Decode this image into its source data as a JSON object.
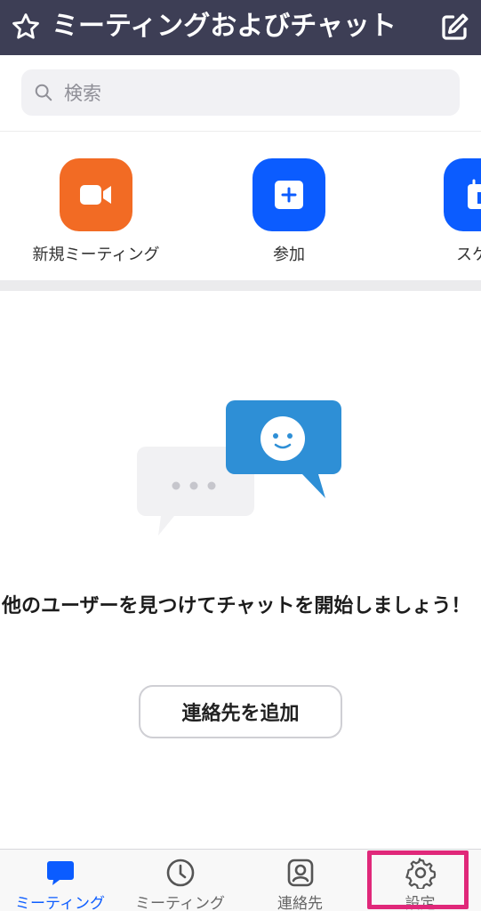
{
  "header": {
    "title": "ミーティングおよびチャット",
    "star_icon": "star-icon",
    "edit_icon": "compose-icon",
    "background_color": "#3d3e55"
  },
  "search": {
    "placeholder": "検索"
  },
  "actions": [
    {
      "label": "新規ミーティング",
      "icon": "video-camera-icon",
      "color": "#f26b24"
    },
    {
      "label": "参加",
      "icon": "plus-icon",
      "color": "#0b5cff"
    },
    {
      "label": "スケジ",
      "icon": "calendar-icon",
      "color": "#0b5cff"
    }
  ],
  "empty_state": {
    "message": "他のユーザーを見つけてチャットを開始しましょう！",
    "button_label": "連絡先を追加"
  },
  "tabbar": {
    "tabs": [
      {
        "label": "ミーティング",
        "icon": "chat-bubble-icon",
        "active": true
      },
      {
        "label": "ミーティング",
        "icon": "clock-icon",
        "active": false
      },
      {
        "label": "連絡先",
        "icon": "contact-icon",
        "active": false
      },
      {
        "label": "設定",
        "icon": "gear-icon",
        "active": false
      }
    ],
    "accent_color": "#0b5cff",
    "highlight_color": "#e0287a"
  }
}
